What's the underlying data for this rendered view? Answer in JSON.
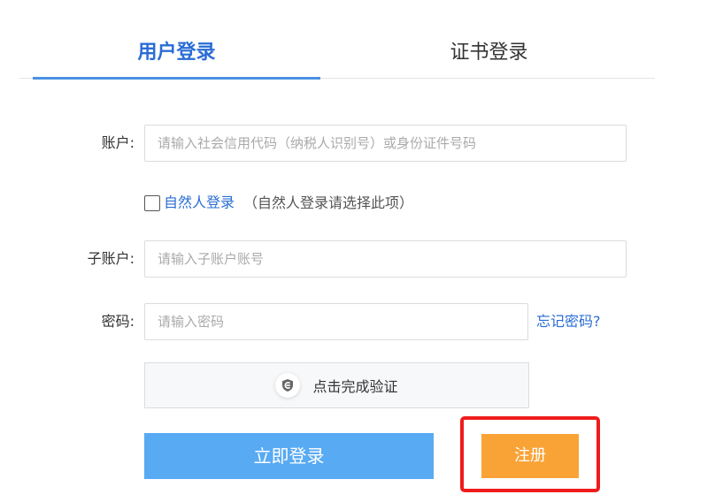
{
  "tabs": [
    {
      "label": "用户登录",
      "active": true
    },
    {
      "label": "证书登录",
      "active": false
    }
  ],
  "form": {
    "account": {
      "label": "账户:",
      "placeholder": "请输入社会信用代码（纳税人识别号）或身份证件号码",
      "value": ""
    },
    "natural_person": {
      "checked": false,
      "link_label": "自然人登录",
      "hint": "（自然人登录请选择此项）"
    },
    "sub_account": {
      "label": "子账户:",
      "placeholder": "请输入子账户账号",
      "value": ""
    },
    "password": {
      "label": "密码:",
      "placeholder": "请输入密码",
      "value": "",
      "forgot_label": "忘记密码?"
    },
    "verify": {
      "label": "点击完成验证",
      "icon": "shield-check-icon"
    }
  },
  "actions": {
    "login_label": "立即登录",
    "register_label": "注册"
  },
  "colors": {
    "accent": "#2a6dd4",
    "tab_underline": "#4a90e2",
    "login_button": "#58aaf2",
    "register_button": "#f9a337",
    "highlight_border": "#ee1c1c"
  }
}
